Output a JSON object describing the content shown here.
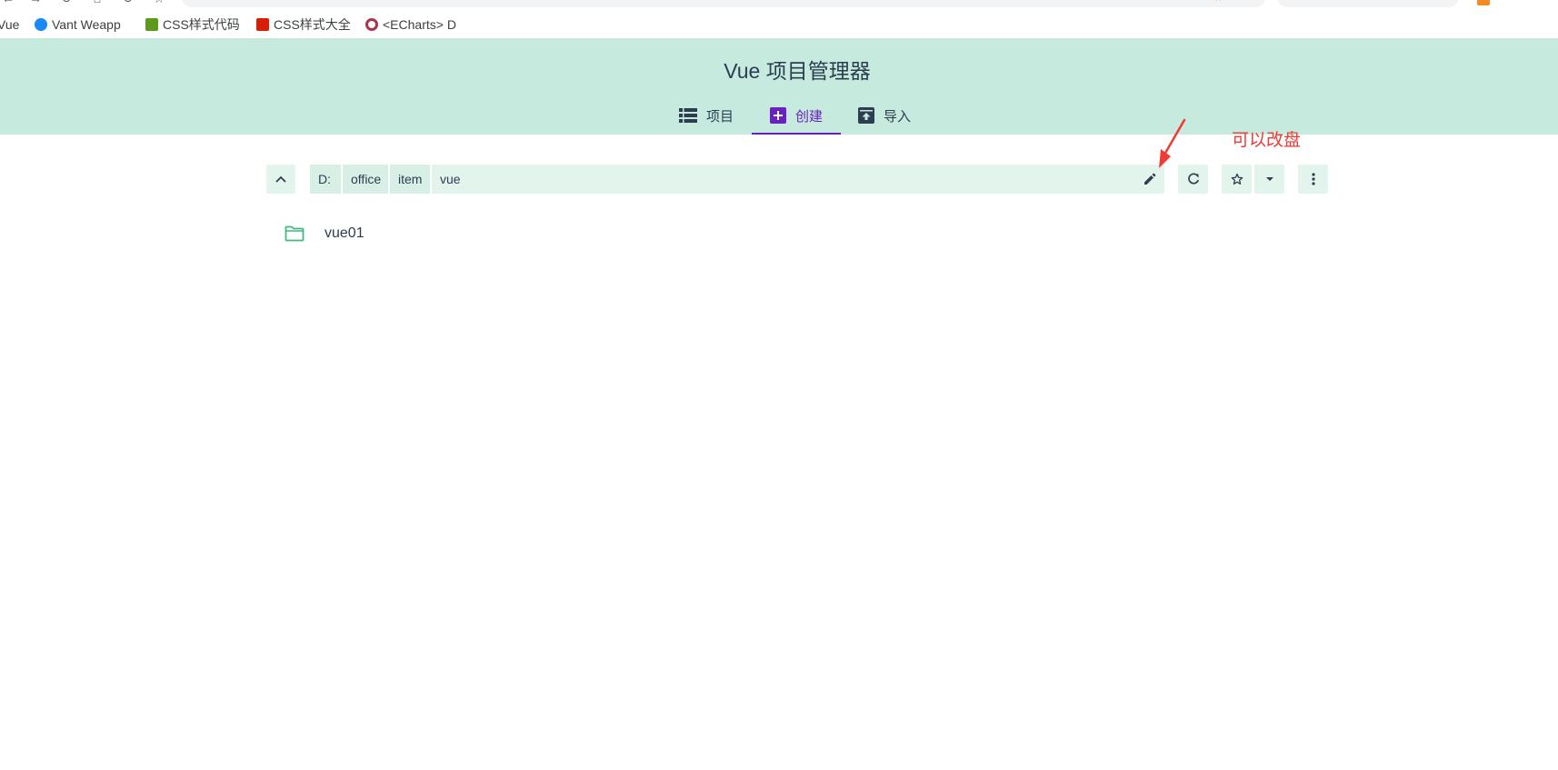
{
  "browser": {
    "bookmarks": [
      {
        "label": "Vue",
        "icon": "vue-bookmark-icon",
        "color": "#41b883"
      },
      {
        "label": "Vant Weapp",
        "icon": "vant-icon",
        "color": "#1989fa"
      },
      {
        "label": "CSS样式代码",
        "icon": "lan-icon",
        "color": "#5b9a1c"
      },
      {
        "label": "CSS样式大全",
        "icon": "c-icon",
        "color": "#d81e06"
      },
      {
        "label": "<ECharts> D",
        "icon": "echarts-icon",
        "color": "#aa344d"
      }
    ]
  },
  "header": {
    "title": "Vue 项目管理器",
    "tabs": [
      {
        "label": "项目",
        "icon": "list-icon",
        "active": false
      },
      {
        "label": "创建",
        "icon": "add-box-icon",
        "active": true
      },
      {
        "label": "导入",
        "icon": "unarchive-icon",
        "active": false
      }
    ]
  },
  "explorer": {
    "path": [
      "D:",
      "office",
      "item",
      "vue"
    ],
    "folders": [
      {
        "name": "vue01",
        "icon": "folder-icon"
      }
    ],
    "buttons": [
      "folder-up-icon",
      "edit-icon",
      "refresh-icon",
      "star-icon",
      "dropdown-icon",
      "more-vert-icon"
    ]
  },
  "annotation": {
    "text": "可以改盘",
    "color": "#ee3b33"
  },
  "colors": {
    "header_bg": "#c6eadd",
    "toolbar_bg": "#e2f4ec",
    "accent": "#6a1fc0",
    "text": "#2c3e50",
    "folder": "#42b983"
  }
}
